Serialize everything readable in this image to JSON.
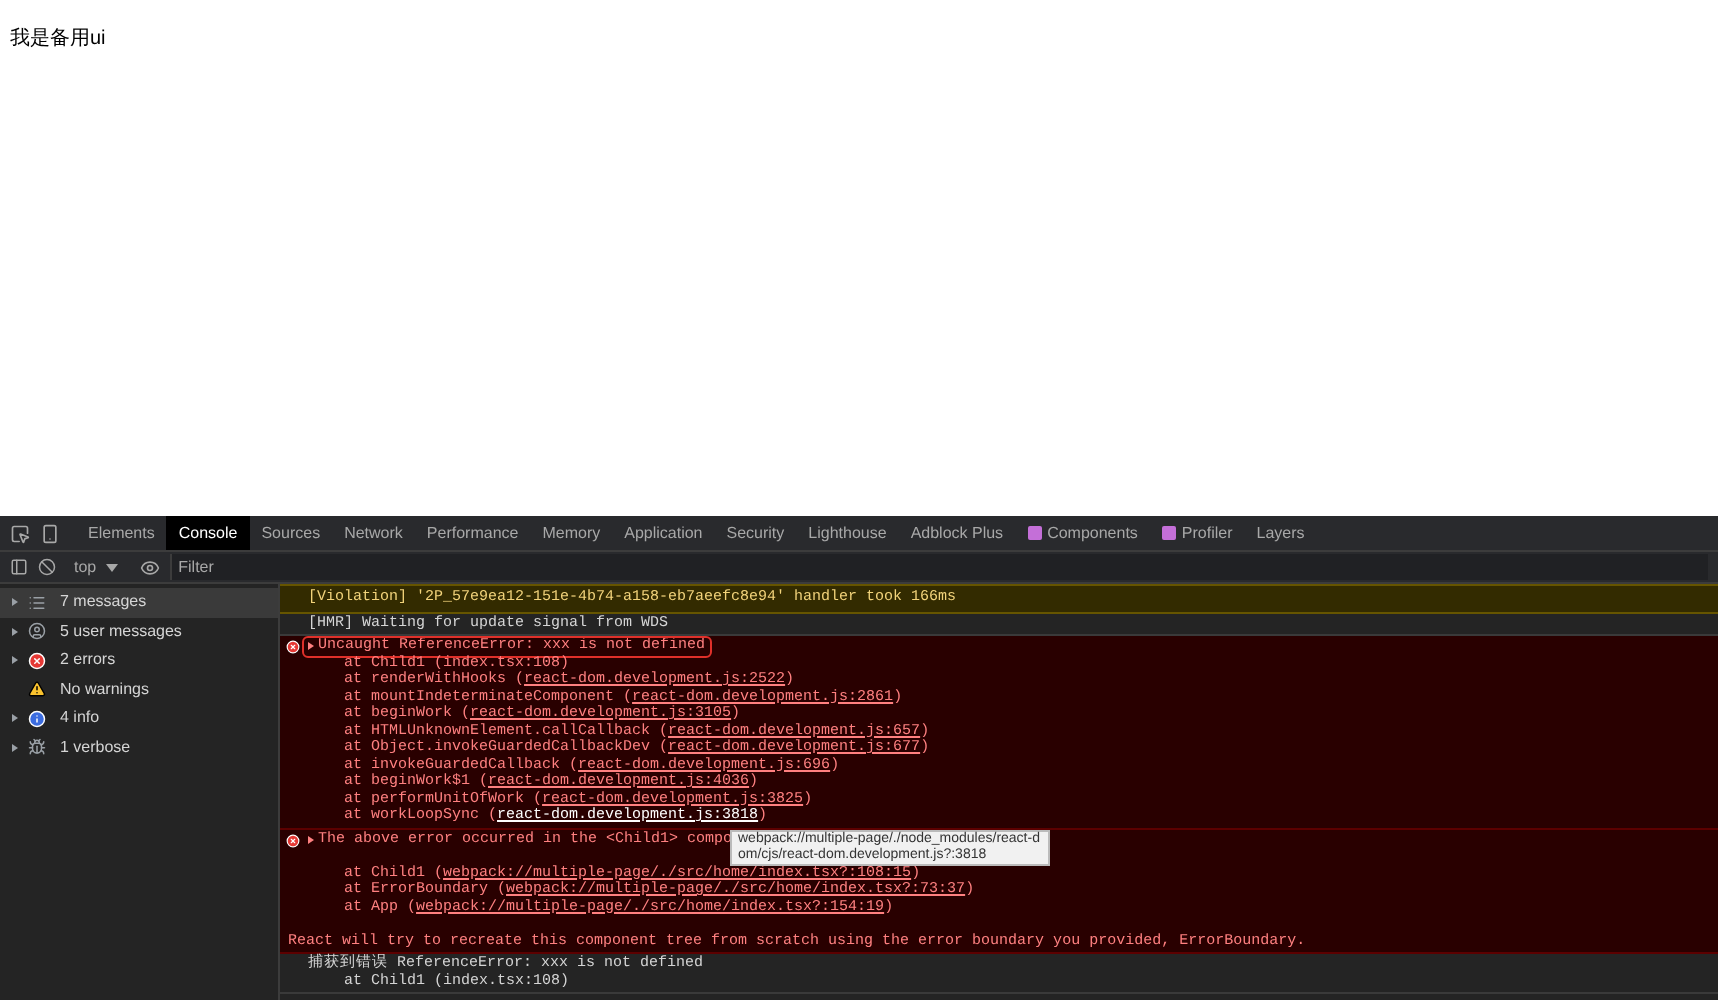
{
  "page": {
    "text": "我是备用ui"
  },
  "tabs": [
    {
      "label": "Elements",
      "selected": false,
      "icon": false
    },
    {
      "label": "Console",
      "selected": true,
      "icon": false
    },
    {
      "label": "Sources",
      "selected": false,
      "icon": false
    },
    {
      "label": "Network",
      "selected": false,
      "icon": false
    },
    {
      "label": "Performance",
      "selected": false,
      "icon": false
    },
    {
      "label": "Memory",
      "selected": false,
      "icon": false
    },
    {
      "label": "Application",
      "selected": false,
      "icon": false
    },
    {
      "label": "Security",
      "selected": false,
      "icon": false
    },
    {
      "label": "Lighthouse",
      "selected": false,
      "icon": false
    },
    {
      "label": "Adblock Plus",
      "selected": false,
      "icon": false
    },
    {
      "label": "Components",
      "selected": false,
      "icon": true
    },
    {
      "label": "Profiler",
      "selected": false,
      "icon": true
    },
    {
      "label": "Layers",
      "selected": false,
      "icon": false
    }
  ],
  "toolbar": {
    "context": "top",
    "filter_placeholder": "Filter"
  },
  "sidebar": {
    "items": [
      {
        "label": "7 messages",
        "kind": "all",
        "selected": true,
        "expandable": true
      },
      {
        "label": "5 user messages",
        "kind": "user",
        "selected": false,
        "expandable": true
      },
      {
        "label": "2 errors",
        "kind": "error",
        "selected": false,
        "expandable": true
      },
      {
        "label": "No warnings",
        "kind": "warning",
        "selected": false,
        "expandable": false
      },
      {
        "label": "4 info",
        "kind": "info",
        "selected": false,
        "expandable": true
      },
      {
        "label": "1 verbose",
        "kind": "verbose",
        "selected": false,
        "expandable": true
      }
    ]
  },
  "messages": [
    {
      "kind": "violation",
      "text": "[Violation] '2P_57e9ea12-151e-4b74-a158-eb7aeefc8e94' handler took 166ms",
      "expandable": false,
      "highlighted": false
    },
    {
      "kind": "log",
      "text": "[HMR] Waiting for update signal from WDS",
      "expandable": false,
      "highlighted": false
    },
    {
      "kind": "error",
      "text": "Uncaught ReferenceError: xxx is not defined",
      "expandable": true,
      "highlighted": true,
      "frames": [
        {
          "prefix": "at Child1 (index.tsx:108)"
        },
        {
          "prefix": "at renderWithHooks (",
          "link": "react-dom.development.js:2522",
          "suffix": ")",
          "hovered": false
        },
        {
          "prefix": "at mountIndeterminateComponent (",
          "link": "react-dom.development.js:2861",
          "suffix": ")",
          "hovered": false
        },
        {
          "prefix": "at beginWork (",
          "link": "react-dom.development.js:3105",
          "suffix": ")",
          "hovered": false
        },
        {
          "prefix": "at HTMLUnknownElement.callCallback (",
          "link": "react-dom.development.js:657",
          "suffix": ")",
          "hovered": false
        },
        {
          "prefix": "at Object.invokeGuardedCallbackDev (",
          "link": "react-dom.development.js:677",
          "suffix": ")",
          "hovered": false
        },
        {
          "prefix": "at invokeGuardedCallback (",
          "link": "react-dom.development.js:696",
          "suffix": ")",
          "hovered": false
        },
        {
          "prefix": "at beginWork$1 (",
          "link": "react-dom.development.js:4036",
          "suffix": ")",
          "hovered": false
        },
        {
          "prefix": "at performUnitOfWork (",
          "link": "react-dom.development.js:3825",
          "suffix": ")",
          "hovered": false
        },
        {
          "prefix": "at workLoopSync (",
          "link": "react-dom.development.js:3818",
          "suffix": ")",
          "hovered": true
        }
      ]
    },
    {
      "kind": "error",
      "text": "The above error occurred in the <Child1> compo",
      "expandable": true,
      "highlighted": false,
      "tooltip": "webpack://multiple-page/./node_modules/react-dom/cjs/react-dom.development.js?:3818",
      "frames": [
        {
          "prefix": "at Child1 (",
          "link": "webpack://multiple-page/./src/home/index.tsx?:108:15",
          "suffix": ")",
          "hovered": false
        },
        {
          "prefix": "at ErrorBoundary (",
          "link": "webpack://multiple-page/./src/home/index.tsx?:73:37",
          "suffix": ")",
          "hovered": false
        },
        {
          "prefix": "at App (",
          "link": "webpack://multiple-page/./src/home/index.tsx?:154:19",
          "suffix": ")",
          "hovered": false
        }
      ],
      "note": "React will try to recreate this component tree from scratch using the error boundary you provided, ErrorBoundary."
    },
    {
      "kind": "log",
      "text": "捕获到错误 ReferenceError: xxx is not defined",
      "expandable": false,
      "highlighted": false,
      "frames": [
        {
          "prefix": "at Child1 (index.tsx:108)"
        }
      ]
    }
  ]
}
